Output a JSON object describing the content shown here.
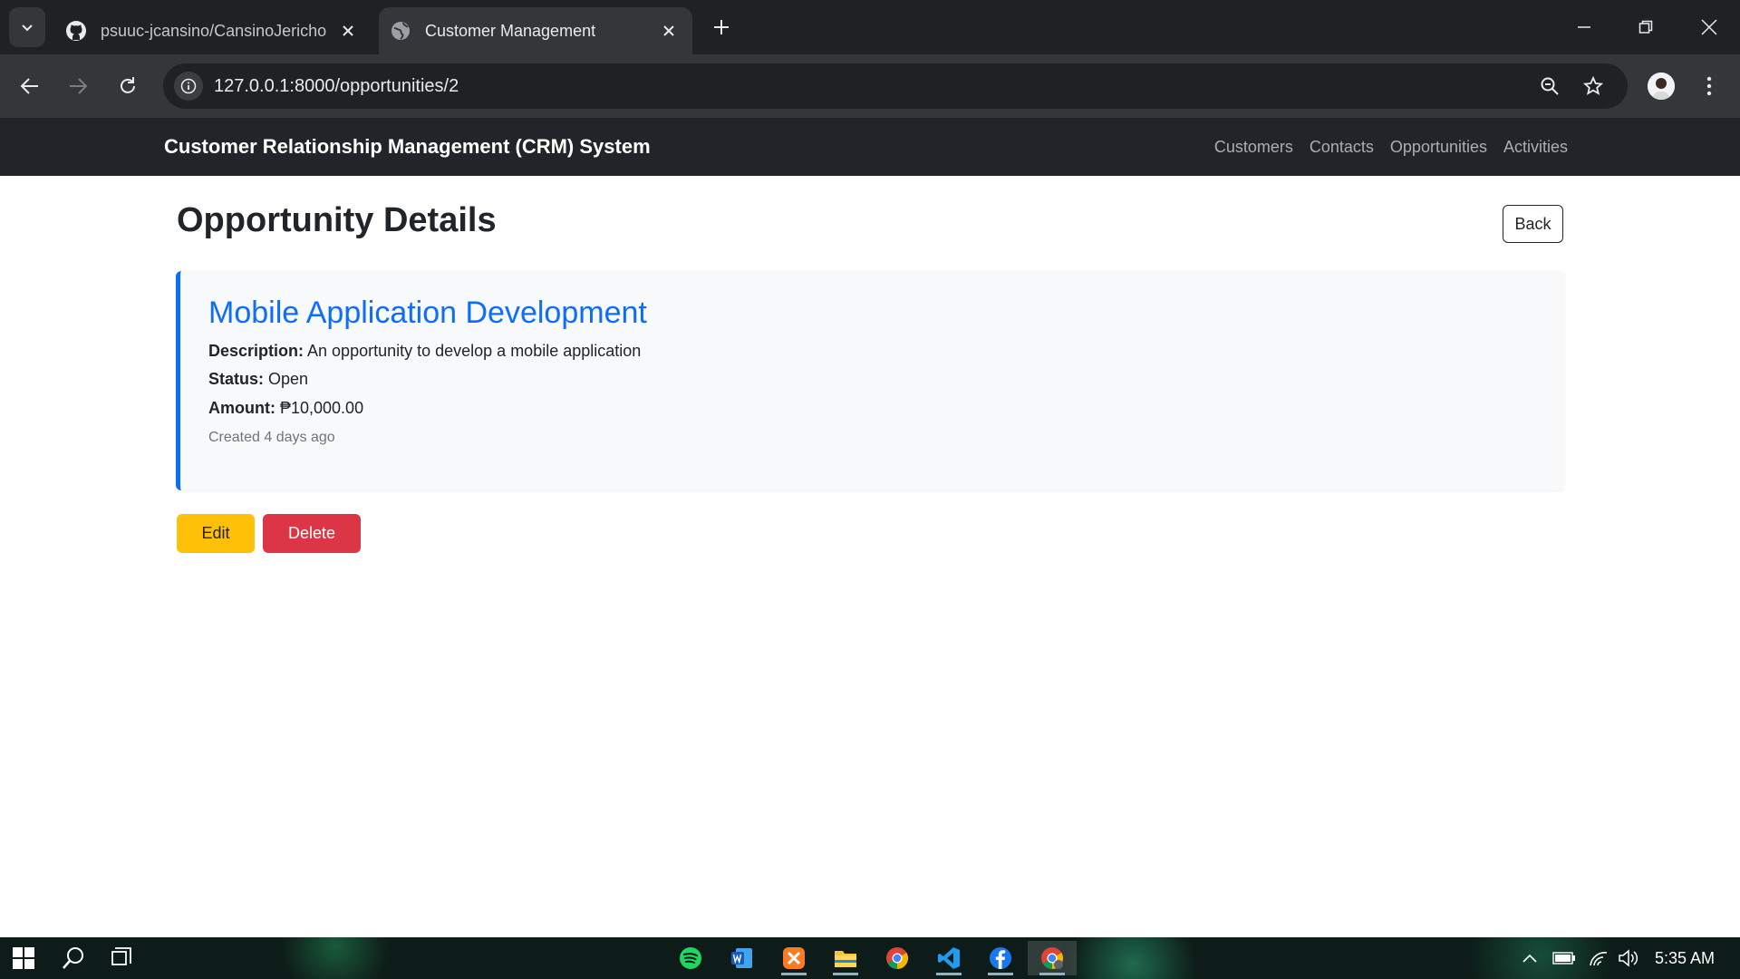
{
  "browser": {
    "tabs": [
      {
        "title": "psuuc-jcansino/CansinoJericho",
        "active": false
      },
      {
        "title": "Customer Management",
        "active": true
      }
    ],
    "url": "127.0.0.1:8000/opportunities/2"
  },
  "navbar": {
    "brand": "Customer Relationship Management (CRM) System",
    "links": [
      "Customers",
      "Contacts",
      "Opportunities",
      "Activities"
    ]
  },
  "page": {
    "title": "Opportunity Details",
    "back_label": "Back"
  },
  "opportunity": {
    "name": "Mobile Application Development",
    "description_label": "Description:",
    "description": "An opportunity to develop a mobile application",
    "status_label": "Status:",
    "status": "Open",
    "amount_label": "Amount:",
    "amount": "₱10,000.00",
    "created": "Created 4 days ago"
  },
  "actions": {
    "edit_label": "Edit",
    "delete_label": "Delete"
  },
  "taskbar": {
    "clock": "5:35 AM"
  },
  "colors": {
    "primary": "#0d6efd",
    "warning": "#ffc107",
    "danger": "#dc3545",
    "navbar": "#212529"
  }
}
